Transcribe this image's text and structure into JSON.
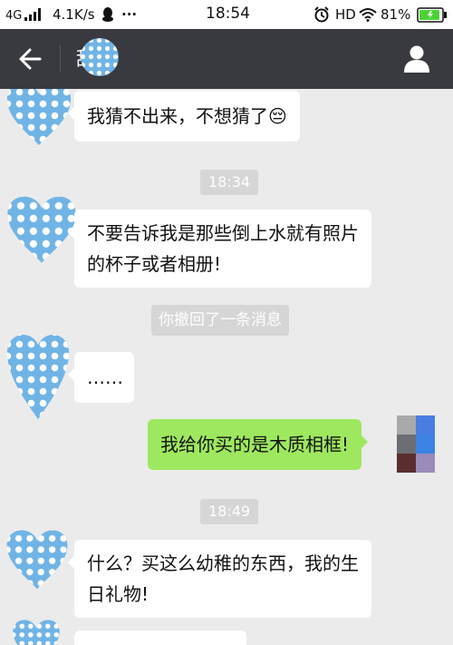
{
  "status_bar": {
    "network": "4G",
    "speed": "4.1K/s",
    "dots": "···",
    "time": "18:54",
    "hd": "HD",
    "battery_pct": "81%"
  },
  "nav": {
    "contact_name": "甜心"
  },
  "messages": [
    {
      "type": "received",
      "text": "我猜不出来，不想猜了😔"
    },
    {
      "type": "timestamp",
      "text": "18:34"
    },
    {
      "type": "received",
      "lines": [
        "不要告诉我是那些倒上水就有照片",
        "的杯子或者相册!"
      ]
    },
    {
      "type": "system",
      "text": "你撤回了一条消息"
    },
    {
      "type": "received",
      "text": "……"
    },
    {
      "type": "sent",
      "text": "我给你买的是木质相框!"
    },
    {
      "type": "timestamp",
      "text": "18:49"
    },
    {
      "type": "received",
      "lines": [
        "什么？买这么幼稚的东西，我的生",
        "日礼物!"
      ]
    }
  ],
  "colors": {
    "nav_bg": "#393a3f",
    "chat_bg": "#ebebeb",
    "sent_bubble": "#9ee85f",
    "avatar_blue": "#70b4e6",
    "battery_green": "#4cd137"
  }
}
